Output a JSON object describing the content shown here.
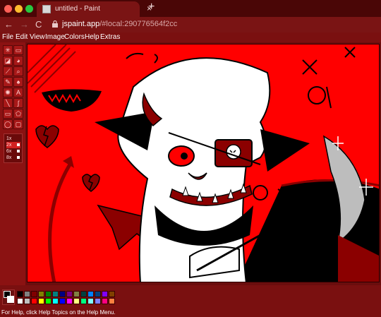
{
  "browser": {
    "tab_title": "untitled - Paint",
    "tab_close": "×",
    "new_tab": "+",
    "url_host": "jspaint.app",
    "url_rest": "/#local:290776564f2cc",
    "back": "←",
    "forward": "→",
    "reload": "C"
  },
  "menu": {
    "file": "File",
    "edit": "Edit",
    "view": "View",
    "image": "Image",
    "colors": "Colors",
    "help": "Help",
    "extras": "Extras"
  },
  "tools": [
    {
      "name": "free-form-select",
      "glyph": "✳"
    },
    {
      "name": "select",
      "glyph": "▭"
    },
    {
      "name": "eraser",
      "glyph": "◪"
    },
    {
      "name": "fill",
      "glyph": "◕"
    },
    {
      "name": "pick-color",
      "glyph": "⟋"
    },
    {
      "name": "magnifier",
      "glyph": "⌕"
    },
    {
      "name": "pencil",
      "glyph": "✎"
    },
    {
      "name": "brush",
      "glyph": "♠"
    },
    {
      "name": "airbrush",
      "glyph": "✺"
    },
    {
      "name": "text",
      "glyph": "A"
    },
    {
      "name": "line",
      "glyph": "╲"
    },
    {
      "name": "curve",
      "glyph": "ʃ"
    },
    {
      "name": "rectangle",
      "glyph": "▭"
    },
    {
      "name": "polygon",
      "glyph": "⬠"
    },
    {
      "name": "ellipse",
      "glyph": "◯"
    },
    {
      "name": "rounded-rectangle",
      "glyph": "▢"
    }
  ],
  "zoom_options": [
    "1x",
    "2x",
    "6x",
    "8x"
  ],
  "palette": {
    "foreground": "#000000",
    "background": "#ffffff",
    "colors_row1": [
      "#000000",
      "#808080",
      "#800000",
      "#808000",
      "#008000",
      "#008080",
      "#000080",
      "#800080",
      "#808040",
      "#004040",
      "#0080ff",
      "#004080",
      "#8000ff",
      "#804000"
    ],
    "colors_row2": [
      "#ffffff",
      "#c0c0c0",
      "#ff0000",
      "#ffff00",
      "#00ff00",
      "#00ffff",
      "#0000ff",
      "#ff00ff",
      "#ffff80",
      "#00ff80",
      "#80ffff",
      "#8080ff",
      "#ff0080",
      "#ff8040"
    ]
  },
  "status": {
    "help_text": "For Help, click Help Topics on the Help Menu."
  },
  "colors": {
    "canvas_bg": "#ff0000",
    "dark_red": "#8b0000",
    "black": "#000000",
    "white": "#ffffff"
  }
}
